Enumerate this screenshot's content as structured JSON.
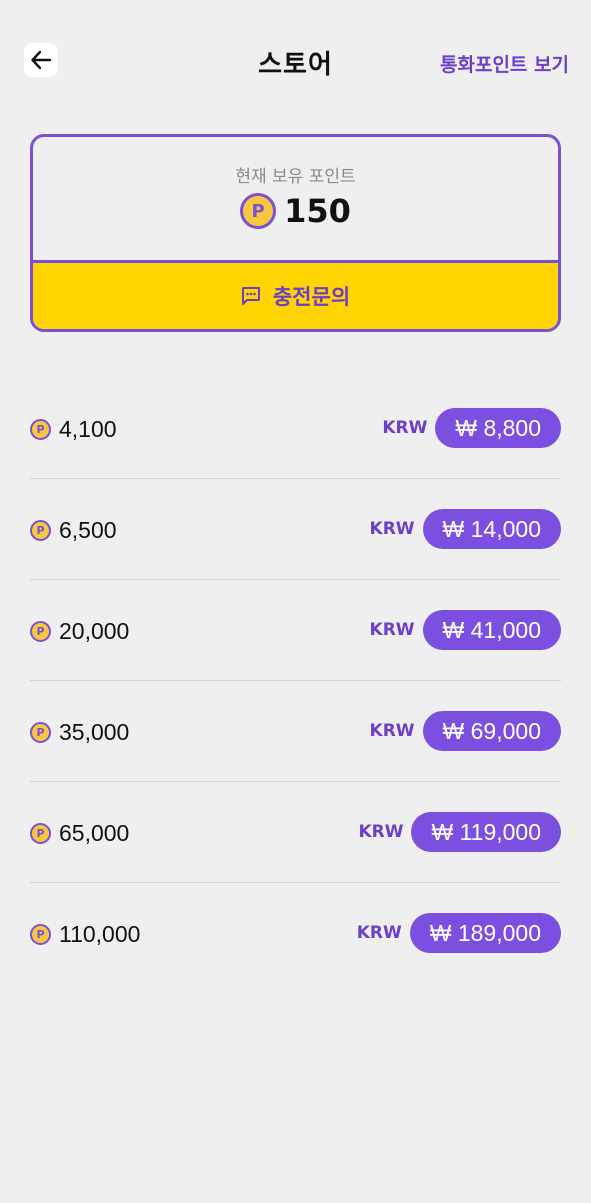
{
  "header": {
    "title": "스토어",
    "back_icon": "arrow-left-icon",
    "link_label": "통화포인트 보기"
  },
  "balance": {
    "label": "현재 보유 포인트",
    "coin_symbol": "P",
    "value": "150",
    "recharge_label": "충전문의",
    "recharge_icon": "chat-bubble-icon"
  },
  "packages": [
    {
      "points": "4,100",
      "currency": "KRW",
      "price": "₩ 8,800"
    },
    {
      "points": "6,500",
      "currency": "KRW",
      "price": "₩ 14,000"
    },
    {
      "points": "20,000",
      "currency": "KRW",
      "price": "₩ 41,000"
    },
    {
      "points": "35,000",
      "currency": "KRW",
      "price": "₩ 69,000"
    },
    {
      "points": "65,000",
      "currency": "KRW",
      "price": "₩ 119,000"
    },
    {
      "points": "110,000",
      "currency": "KRW",
      "price": "₩ 189,000"
    }
  ],
  "colors": {
    "accent_purple": "#7b4fe0",
    "recharge_yellow": "#ffd400",
    "coin_gold": "#f6c842",
    "background": "#efeff0"
  }
}
